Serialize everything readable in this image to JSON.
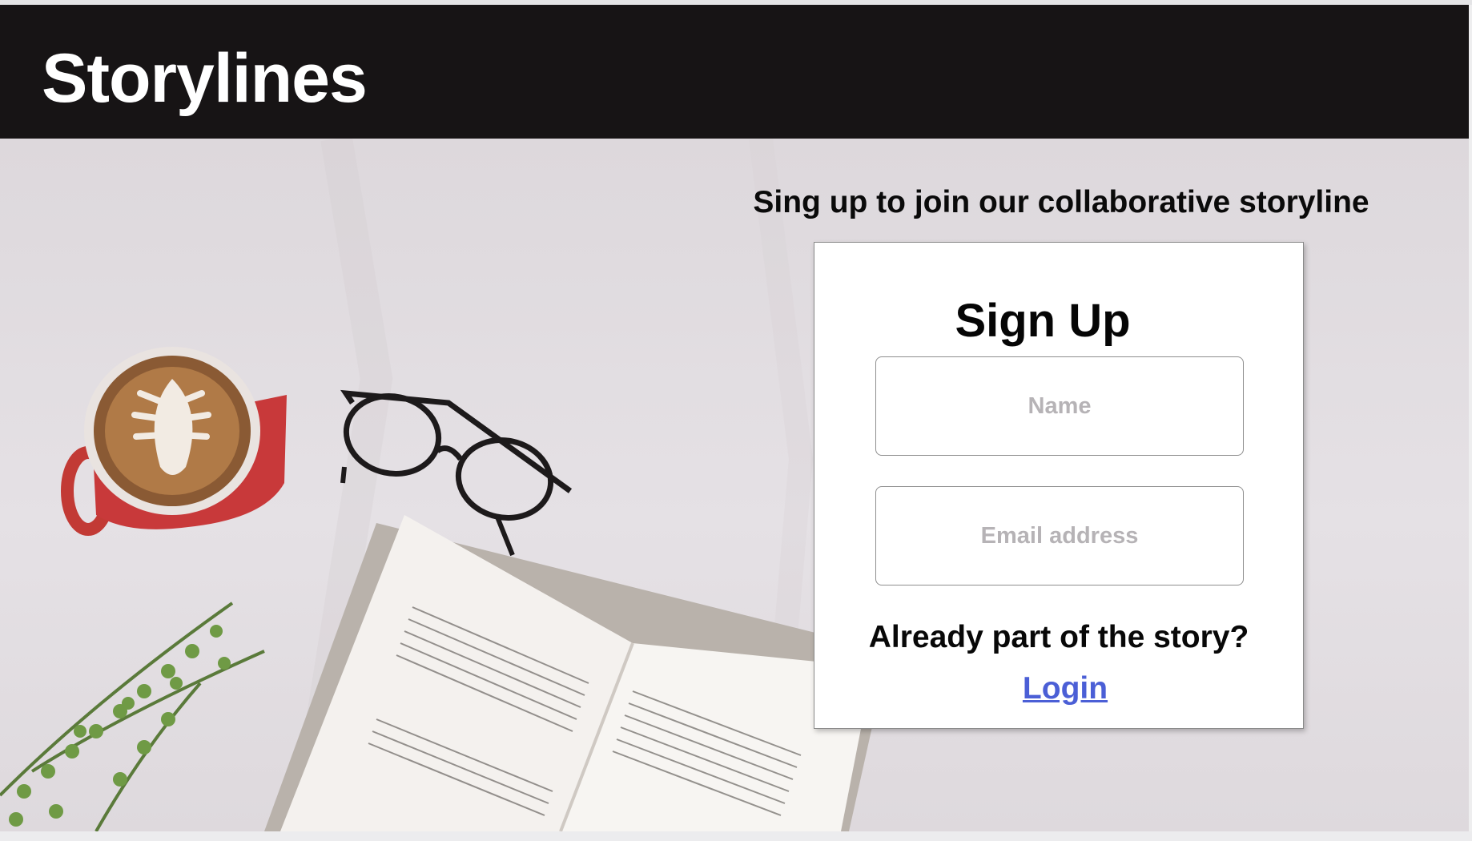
{
  "header": {
    "brand": "Storylines"
  },
  "hero": {
    "tagline": "Sing up to join our collaborative storyline"
  },
  "signup_card": {
    "title": "Sign Up",
    "name_placeholder": "Name",
    "name_value": "",
    "email_placeholder": "Email address",
    "email_value": "",
    "already_text": "Already part of the story?",
    "login_label": "Login"
  },
  "colors": {
    "header_bg": "#171415",
    "brand_text": "#ffffff",
    "link": "#4b5fd6",
    "placeholder": "#b6b3b6",
    "card_bg": "#ffffff"
  }
}
